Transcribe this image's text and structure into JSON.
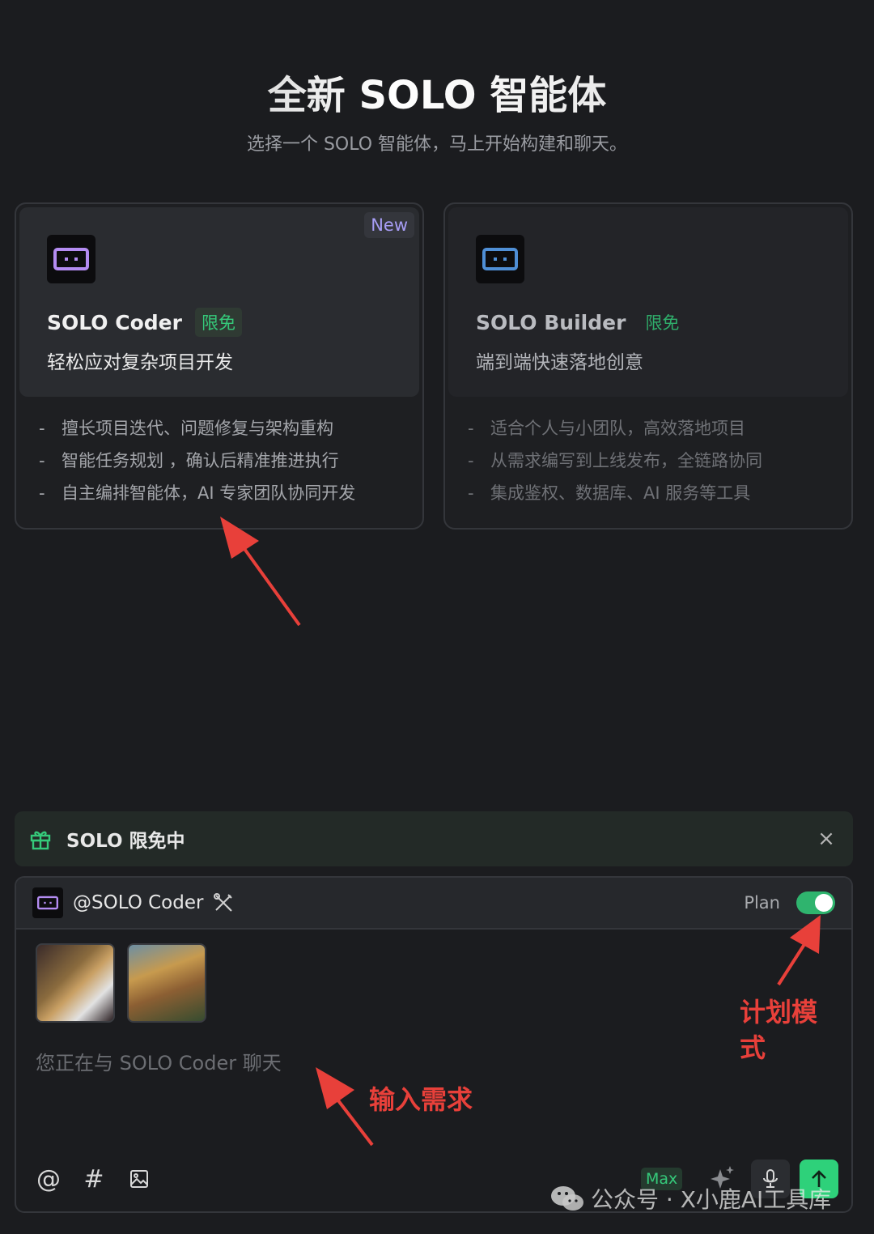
{
  "hero": {
    "title": "全新 SOLO 智能体",
    "subtitle": "选择一个 SOLO 智能体，马上开始构建和聊天。"
  },
  "cards": [
    {
      "badge": "New",
      "name": "SOLO Coder",
      "tag": "限免",
      "description": "轻松应对复杂项目开发",
      "features": [
        "擅长项目迭代、问题修复与架构重构",
        "智能任务规划 ，确认后精准推进执行",
        "自主编排智能体，AI 专家团队协同开发"
      ],
      "icon": "solo-agent-icon",
      "icon_color": "#b48cf2"
    },
    {
      "name": "SOLO Builder",
      "tag": "限免",
      "description": "端到端快速落地创意",
      "features": [
        "适合个人与小团队，高效落地项目",
        "从需求编写到上线发布，全链路协同",
        "集成鉴权、数据库、AI 服务等工具"
      ],
      "icon": "solo-agent-icon",
      "icon_color": "#4f8fd6"
    }
  ],
  "promo": {
    "text": "SOLO 限免中",
    "icon": "gift-icon",
    "close": "×"
  },
  "chat": {
    "agent": "@SOLO Coder",
    "plan_label": "Plan",
    "plan_enabled": true,
    "placeholder": "您正在与 SOLO Coder 聊天",
    "tools": {
      "at": "@",
      "hash": "#"
    },
    "model_badge": "Max",
    "accent": "#2ed17a"
  },
  "annotations": {
    "plan_mode": "计划模式",
    "input_request": "输入需求"
  },
  "watermark": "公众号 · X小鹿AI工具库"
}
